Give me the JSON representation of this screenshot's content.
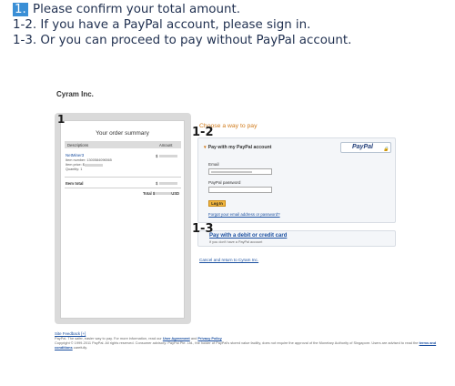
{
  "instructions": {
    "step1_badge": "1.",
    "step1_text": "Please confirm your total amount.",
    "step2": "1-2. If you have a PayPal account, please sign in.",
    "step3": "1-3. Or you can proceed to pay without PayPal account."
  },
  "merchant_name": "Cyram Inc.",
  "order": {
    "title": "Your order summary",
    "col_description": "Descriptions",
    "col_amount": "Amount",
    "item_name": "NetMiner3",
    "item_number": "Item number: 1300584096565",
    "item_price": "Item price: $",
    "quantity": "Quantity: 1",
    "currency": "$",
    "item_total_label": "Item total",
    "total_label": "Total $",
    "total_currency": "USD"
  },
  "choose_label": "Choose a way to pay",
  "paypal_section": {
    "toggle_label": "Pay with my PayPal account",
    "logo_text": "PayPal",
    "email_label": "Email",
    "password_label": "PayPal password",
    "login_button": "Log In",
    "forgot_link": "Forgot your email address or password?"
  },
  "card_section": {
    "link": "Pay with a debit or credit card",
    "sub": "If you don't have a PayPal account"
  },
  "cancel_link": "Cancel and return to Cyram Inc.",
  "markers": {
    "m1": "1",
    "m12": "1-2",
    "m13": "1-3"
  },
  "footer": {
    "feedback": "Site Feedback [+]",
    "line1_pre": "PayPal. The safer, easier way to pay. For more information, read our",
    "user_agreement": "User Agreement",
    "and": "and",
    "privacy_policy": "Privacy Policy",
    "line2": "Copyright © 1999-2011 PayPal. All rights reserved. Consumer advisory: PayPal Pte. Ltd., the holder of PayPal's stored value facility, does not require the approval of the Monetary Authority of Singapore. Users are advised to read the",
    "terms": "terms and conditions",
    "line2_post": "carefully."
  }
}
